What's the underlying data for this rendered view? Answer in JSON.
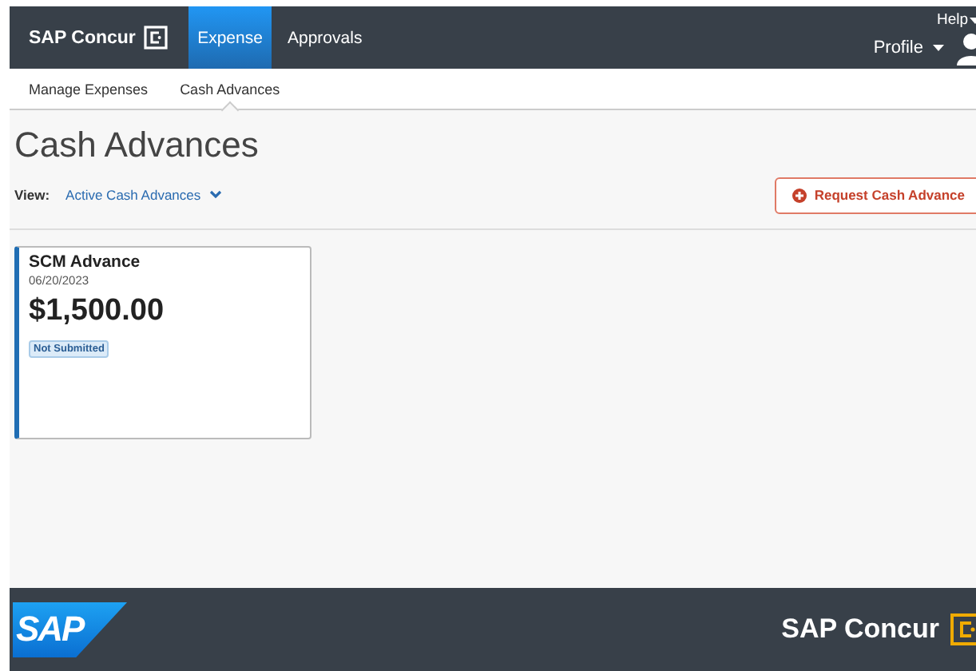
{
  "header": {
    "brand": "SAP Concur",
    "tabs": [
      {
        "label": "Expense",
        "selected": true
      },
      {
        "label": "Approvals",
        "selected": false
      }
    ],
    "help": "Help",
    "profile": "Profile"
  },
  "subnav": [
    {
      "label": "Manage Expenses",
      "selected": false
    },
    {
      "label": "Cash Advances",
      "selected": true
    }
  ],
  "title": "Cash Advances",
  "view": {
    "label": "View:",
    "value": "Active Cash Advances"
  },
  "request_button": "Request Cash Advance",
  "cards": [
    {
      "name": "SCM Advance",
      "date": "06/20/2023",
      "amount": "$1,500.00",
      "status": "Not Submitted"
    }
  ],
  "footer": {
    "sap_logo": "SAP",
    "brand": "SAP Concur"
  }
}
